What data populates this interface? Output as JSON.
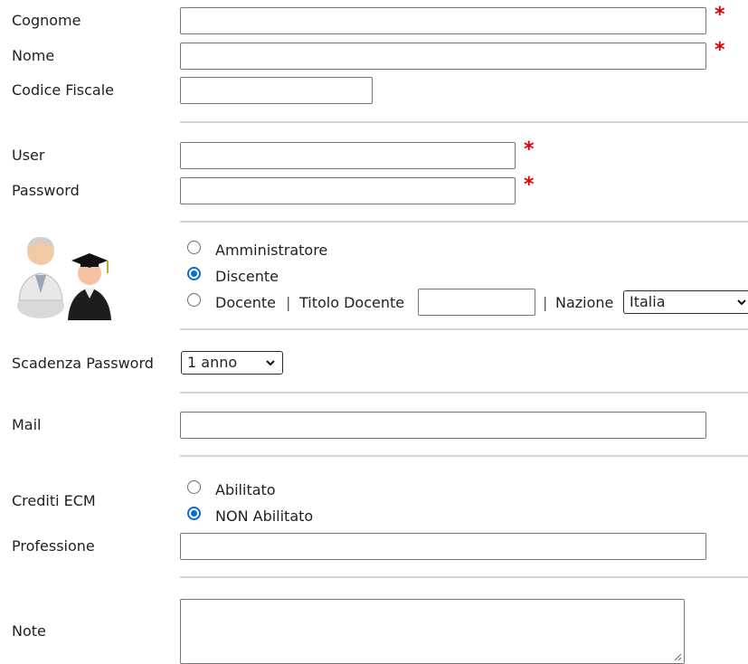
{
  "fields": {
    "cognome": {
      "label": "Cognome",
      "value": ""
    },
    "nome": {
      "label": "Nome",
      "value": ""
    },
    "codice_fiscale": {
      "label": "Codice Fiscale",
      "value": ""
    },
    "user": {
      "label": "User",
      "value": ""
    },
    "password": {
      "label": "Password",
      "value": ""
    },
    "scadenza_password": {
      "label": "Scadenza Password",
      "selected": "1 anno"
    },
    "mail": {
      "label": "Mail",
      "value": ""
    },
    "crediti_ecm": {
      "label": "Crediti ECM"
    },
    "professione": {
      "label": "Professione",
      "value": ""
    },
    "note": {
      "label": "Note",
      "value": ""
    }
  },
  "required_mark": "*",
  "roles": {
    "icon": "users-admin-student-icon",
    "options": [
      {
        "label": "Amministratore",
        "selected": false
      },
      {
        "label": "Discente",
        "selected": true
      },
      {
        "label": "Docente",
        "selected": false
      }
    ],
    "separator": "|",
    "titolo_docente_label": "Titolo Docente",
    "titolo_docente_value": "",
    "nazione_label": "Nazione",
    "nazione_selected": "Italia"
  },
  "ecm_options": [
    {
      "label": "Abilitato",
      "selected": false
    },
    {
      "label": "NON Abilitato",
      "selected": true
    }
  ],
  "colors": {
    "required": "#e00000",
    "radio_selected": "#0a6bd6"
  }
}
